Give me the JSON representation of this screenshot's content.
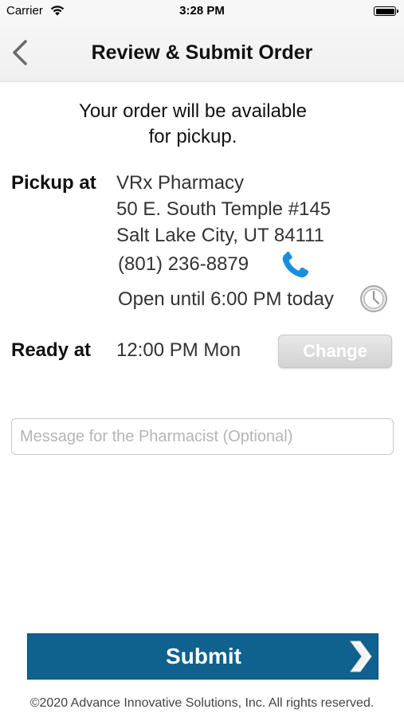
{
  "status_bar": {
    "carrier": "Carrier",
    "time": "3:28 PM"
  },
  "nav": {
    "title": "Review & Submit Order",
    "back_icon": "chevron-left-icon"
  },
  "intro": {
    "line1": "Your order will be available",
    "line2": "for pickup."
  },
  "pickup": {
    "label": "Pickup at",
    "name": "VRx Pharmacy",
    "address1": "50 E. South Temple #145",
    "address2": "Salt Lake City, UT 84111",
    "phone": "(801) 236-8879",
    "phone_icon": "phone-icon",
    "hours": "Open until 6:00 PM today",
    "hours_icon": "clock-icon"
  },
  "ready": {
    "label": "Ready at",
    "time": "12:00 PM Mon",
    "change_label": "Change"
  },
  "message": {
    "placeholder": "Message for the Pharmacist (Optional)",
    "value": ""
  },
  "submit": {
    "label": "Submit",
    "icon": "chevron-right-icon"
  },
  "footer": {
    "copyright": "©2020 Advance Innovative Solutions, Inc. All rights reserved."
  },
  "colors": {
    "submit_bg": "#0f618e",
    "phone_icon": "#1a8de0",
    "change_button_bg": "#d9d9d9"
  }
}
